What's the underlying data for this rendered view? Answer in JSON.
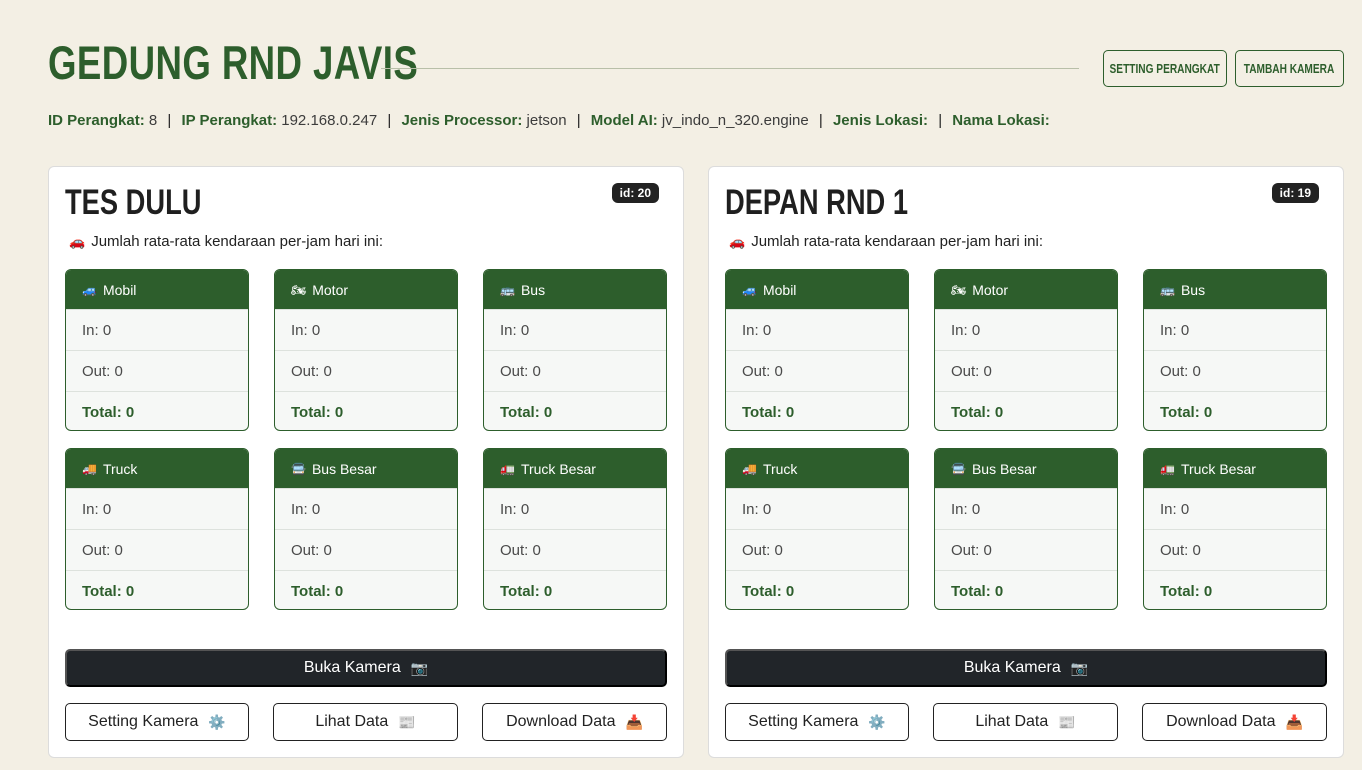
{
  "header": {
    "title": "GEDUNG RND JAVIS",
    "setting_perangkat_label": "SETTING PERANGKAT",
    "tambah_kamera_label": "TAMBAH KAMERA"
  },
  "device_info": {
    "id_label": "ID Perangkat:",
    "id_value": "8",
    "ip_label": "IP Perangkat:",
    "ip_value": "192.168.0.247",
    "processor_label": "Jenis Processor:",
    "processor_value": "jetson",
    "model_label": "Model AI:",
    "model_value": "jv_indo_n_320.engine",
    "lokasi_label": "Jenis Lokasi:",
    "lokasi_value": "",
    "nama_lokasi_label": "Nama Lokasi:",
    "nama_lokasi_value": "",
    "separator": "|"
  },
  "cameras": [
    {
      "name": "TES DULU",
      "badge": "id: 20",
      "avg_text": "Jumlah rata-rata kendaraan per-jam hari ini:",
      "vehicles": [
        {
          "label": "Mobil",
          "icon": "car-icon",
          "in": "In: 0",
          "out": "Out: 0",
          "total": "Total: 0"
        },
        {
          "label": "Motor",
          "icon": "motorcycle-icon",
          "in": "In: 0",
          "out": "Out: 0",
          "total": "Total: 0"
        },
        {
          "label": "Bus",
          "icon": "bus-icon",
          "in": "In: 0",
          "out": "Out: 0",
          "total": "Total: 0"
        },
        {
          "label": "Truck",
          "icon": "truck-icon",
          "in": "In: 0",
          "out": "Out: 0",
          "total": "Total: 0"
        },
        {
          "label": "Bus Besar",
          "icon": "big-bus-icon",
          "in": "In: 0",
          "out": "Out: 0",
          "total": "Total: 0"
        },
        {
          "label": "Truck Besar",
          "icon": "big-truck-icon",
          "in": "In: 0",
          "out": "Out: 0",
          "total": "Total: 0"
        }
      ],
      "open_label": "Buka Kamera",
      "setting_label": "Setting Kamera",
      "view_label": "Lihat Data",
      "download_label": "Download Data"
    },
    {
      "name": "DEPAN RND 1",
      "badge": "id: 19",
      "avg_text": "Jumlah rata-rata kendaraan per-jam hari ini:",
      "vehicles": [
        {
          "label": "Mobil",
          "icon": "car-icon",
          "in": "In: 0",
          "out": "Out: 0",
          "total": "Total: 0"
        },
        {
          "label": "Motor",
          "icon": "motorcycle-icon",
          "in": "In: 0",
          "out": "Out: 0",
          "total": "Total: 0"
        },
        {
          "label": "Bus",
          "icon": "bus-icon",
          "in": "In: 0",
          "out": "Out: 0",
          "total": "Total: 0"
        },
        {
          "label": "Truck",
          "icon": "truck-icon",
          "in": "In: 0",
          "out": "Out: 0",
          "total": "Total: 0"
        },
        {
          "label": "Bus Besar",
          "icon": "big-bus-icon",
          "in": "In: 0",
          "out": "Out: 0",
          "total": "Total: 0"
        },
        {
          "label": "Truck Besar",
          "icon": "big-truck-icon",
          "in": "In: 0",
          "out": "Out: 0",
          "total": "Total: 0"
        }
      ],
      "open_label": "Buka Kamera",
      "setting_label": "Setting Kamera",
      "view_label": "Lihat Data",
      "download_label": "Download Data"
    }
  ],
  "colors": {
    "brand_green": "#2d5e2c",
    "background": "#f3efe4",
    "dark_button": "#212529"
  }
}
